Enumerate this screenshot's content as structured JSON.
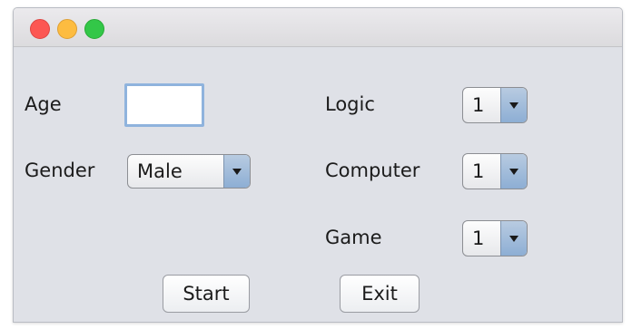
{
  "window": {
    "controls": [
      "close-button",
      "minimize-button",
      "zoom-button"
    ],
    "colors": {
      "close": "#fc5753",
      "minimize": "#fdbc40",
      "zoom": "#33c748"
    }
  },
  "form": {
    "age_label": "Age",
    "age_value": "",
    "gender_label": "Gender",
    "gender_value": "Male",
    "logic_label": "Logic",
    "logic_value": "1",
    "computer_label": "Computer",
    "computer_value": "1",
    "game_label": "Game",
    "game_value": "1"
  },
  "buttons": {
    "start_label": "Start",
    "exit_label": "Exit"
  }
}
